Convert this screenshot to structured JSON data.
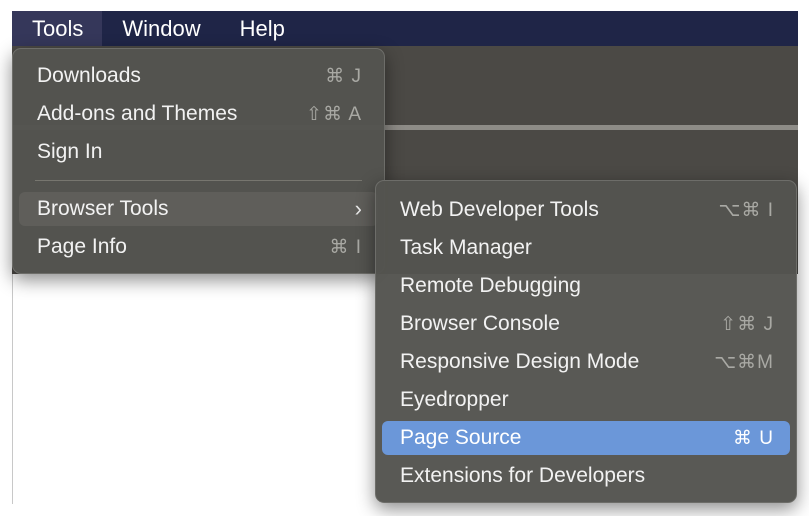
{
  "menubar": {
    "items": [
      {
        "label": "Tools"
      },
      {
        "label": "Window"
      },
      {
        "label": "Help"
      }
    ]
  },
  "tools_menu": {
    "items": [
      {
        "label": "Downloads",
        "shortcut": "⌘ J"
      },
      {
        "label": "Add-ons and Themes",
        "shortcut": "⇧⌘ A"
      },
      {
        "label": "Sign In",
        "shortcut": ""
      },
      {
        "label": "Browser Tools",
        "submenu_icon": "chevron-right-icon"
      },
      {
        "label": "Page Info",
        "shortcut": "⌘ I"
      }
    ]
  },
  "browser_tools_menu": {
    "items": [
      {
        "label": "Web Developer Tools",
        "shortcut": "⌥⌘ I"
      },
      {
        "label": "Task Manager",
        "shortcut": ""
      },
      {
        "label": "Remote Debugging",
        "shortcut": ""
      },
      {
        "label": "Browser Console",
        "shortcut": "⇧⌘ J"
      },
      {
        "label": "Responsive Design Mode",
        "shortcut": "⌥⌘M"
      },
      {
        "label": "Eyedropper",
        "shortcut": ""
      },
      {
        "label": "Page Source",
        "shortcut": "⌘ U"
      },
      {
        "label": "Extensions for Developers",
        "shortcut": ""
      }
    ]
  },
  "colors": {
    "menubar": "#1f2547",
    "menu_bg": "#545450",
    "selection": "#6b97d9"
  }
}
